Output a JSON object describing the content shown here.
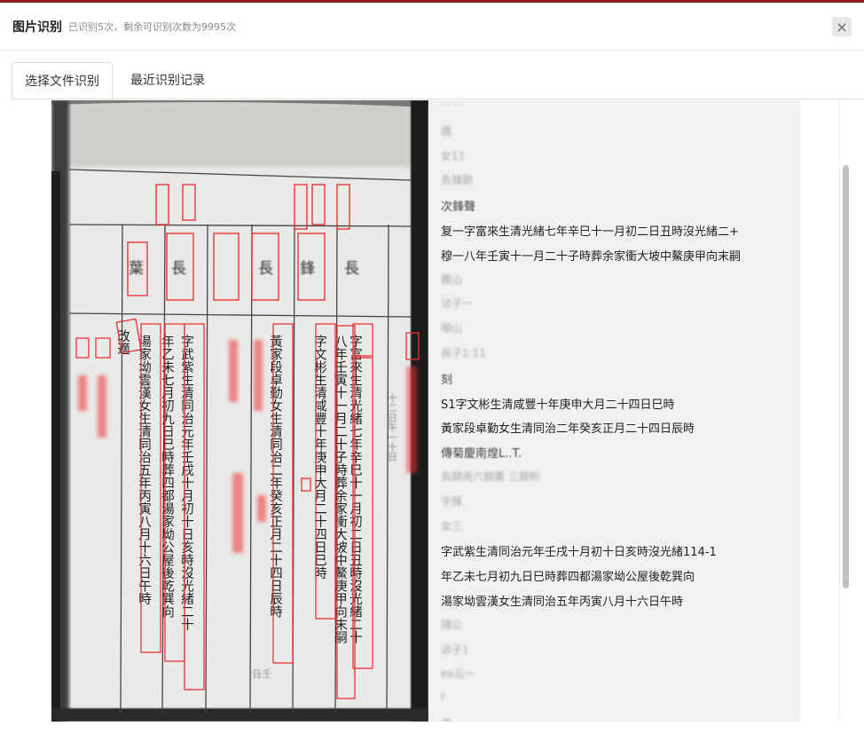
{
  "header": {
    "title": "图片识别",
    "subtitle": "已识别5次，剩余可识别次数为9995次",
    "close_label": "×"
  },
  "tabs": [
    {
      "label": "选择文件识别",
      "active": true
    },
    {
      "label": "最近识别记录",
      "active": false
    }
  ],
  "results": {
    "lines": [
      {
        "text": "· · · ·",
        "style": "dim"
      },
      {
        "text": "偶",
        "style": "dim"
      },
      {
        "text": "女11",
        "style": "dim"
      },
      {
        "text": "長鋒節",
        "style": "dim"
      },
      {
        "text": "次鋒聲",
        "style": "mid"
      },
      {
        "text": "复一字富來生清光緒七年辛巳十一月初二日丑時沒光緒二+",
        "style": "normal"
      },
      {
        "text": "穆一八年壬寅十一月二十子時葬余家衝大坡中鰲庚甲向末嗣",
        "style": "normal"
      },
      {
        "text": "麓山",
        "style": "dim"
      },
      {
        "text": "淡子一",
        "style": "dim"
      },
      {
        "text": "喉山",
        "style": "dim"
      },
      {
        "text": "長子1:11",
        "style": "dim"
      },
      {
        "text": "刻",
        "style": "mid"
      },
      {
        "text": "S1字文彬生清咸豐十年庚申大月二十四日巳時",
        "style": "normal"
      },
      {
        "text": "黃家段卓勤女生清同治二年癸亥正月二十四日辰時",
        "style": "normal"
      },
      {
        "text": "傳菊慶南煌L..T.",
        "style": "mid"
      },
      {
        "text": "長錦亮六錦囊 三錦粉",
        "style": "dim"
      },
      {
        "text": "字鋒",
        "style": "dim"
      },
      {
        "text": "女三",
        "style": "dim"
      },
      {
        "text": "字武紫生清同治元年壬戌十月初十日亥時沒光緒114-1",
        "style": "normal"
      },
      {
        "text": "年乙未七月初九日巳時葬四都湯家坳公屋後乾巽向",
        "style": "normal"
      },
      {
        "text": "湯家坳雲漢女生清同治五年丙寅八月十六日午時",
        "style": "normal"
      },
      {
        "text": "隨公",
        "style": "dim"
      },
      {
        "text": "淡子1",
        "style": "dim"
      },
      {
        "text": "ea云一",
        "style": "dim"
      },
      {
        "text": "r",
        "style": "dim"
      },
      {
        "text": "弟",
        "style": "dim"
      }
    ]
  },
  "document": {
    "cols_right": [
      "字富來生清光緒七年辛巳十一月初二日丑時沒光緒二十",
      "八年壬寅十一月二十子時葬余家衝大坡中鰲庚甲向末嗣",
      "字文彬生清咸豐十年庚申大月二十四日巳時",
      "黃家段卓勤女生清同治二年癸亥正月二十四日辰時"
    ],
    "cols_left": [
      "字武紫生清同治元年壬戌十月初十日亥時沒光緒二十",
      "年乙未七月初九日巳時葬四都湯家坳公屋後乾巽向",
      "湯家坳雲漢女生清同治五年丙寅八月十六日午時",
      "改適"
    ]
  }
}
